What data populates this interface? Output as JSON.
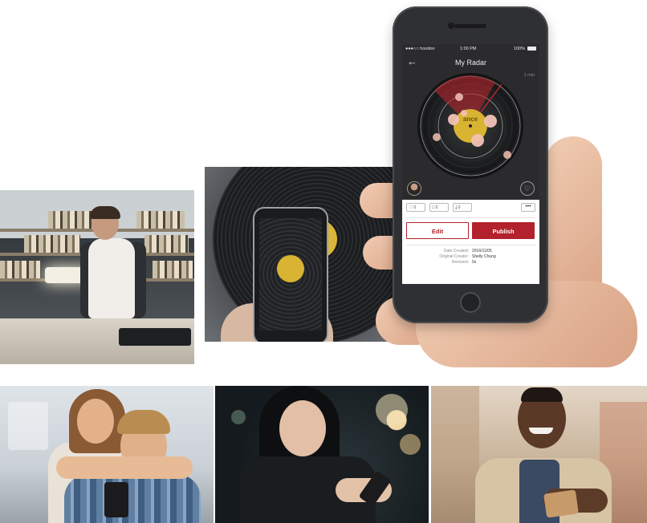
{
  "app": {
    "status_bar": {
      "carrier": "●●●○○ hoodoo",
      "time": "1:00 PM",
      "battery": "100%"
    },
    "nav": {
      "back_icon": "back-arrow-icon",
      "title": "My Radar"
    },
    "radar": {
      "range_label": "1 min",
      "record_label_text": "ance"
    },
    "actions": {
      "like": {
        "icon": "heart-icon",
        "count": "0"
      },
      "comment": {
        "icon": "comment-icon",
        "count": "0"
      },
      "download": {
        "icon": "download-icon",
        "count": "0"
      },
      "more": "•••"
    },
    "buttons": {
      "edit": "Edit",
      "publish": "Publish"
    },
    "meta": {
      "date_created_label": "Date Created:",
      "date_created": "2016/11/05",
      "original_creator_label": "Original Creator:",
      "original_creator": "Shelly Chung",
      "remixed_label": "Remixed:",
      "remixed": "0x"
    },
    "colors": {
      "accent": "#b3212c",
      "screen_bg": "#2b2b2d",
      "record_label": "#d8b432"
    }
  }
}
